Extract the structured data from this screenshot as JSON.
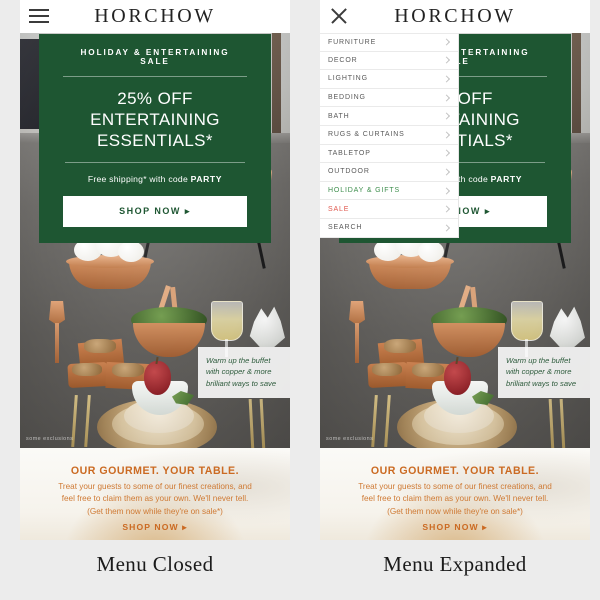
{
  "brand": "HORCHOW",
  "icons": {
    "hamburger": "hamburger-menu-icon",
    "close": "close-x-icon",
    "chevron": "chevron-right-icon",
    "arrow": "▸"
  },
  "promo": {
    "eyebrow": "HOLIDAY & ENTERTAINING SALE",
    "headline_line1": "25% OFF",
    "headline_line2": "ENTERTAINING ESSENTIALS*",
    "shipping_pre": "Free shipping* with code ",
    "shipping_code": "PARTY",
    "cta": "SHOP NOW ▸",
    "bg_color": "#1e5632",
    "text_color": "#ffffff"
  },
  "hero": {
    "callout": "Warm up the buffet with copper & more brilliant ways to save",
    "callout_color": "#2d5b3c",
    "exclusions": "some exclusions"
  },
  "gourmet": {
    "title": "OUR GOURMET. YOUR TABLE.",
    "body_line1": "Treat your guests to some of our finest creations, and",
    "body_line2": "feel free to claim them as your own. We'll never tell.",
    "body_line3": "(Get them now while they're on sale*)",
    "cta": "SHOP NOW ▸",
    "accent_color": "#cb6a22"
  },
  "nav": {
    "items": [
      {
        "label": "FURNITURE",
        "style": "default"
      },
      {
        "label": "DECOR",
        "style": "default"
      },
      {
        "label": "LIGHTING",
        "style": "default"
      },
      {
        "label": "BEDDING",
        "style": "default"
      },
      {
        "label": "BATH",
        "style": "default"
      },
      {
        "label": "RUGS & CURTAINS",
        "style": "default"
      },
      {
        "label": "TABLETOP",
        "style": "default"
      },
      {
        "label": "OUTDOOR",
        "style": "default"
      },
      {
        "label": "HOLIDAY & GIFTS",
        "style": "green"
      },
      {
        "label": "SALE",
        "style": "red"
      },
      {
        "label": "SEARCH",
        "style": "default"
      }
    ],
    "green_color": "#3f8f4e",
    "red_color": "#e0584e"
  },
  "captions": {
    "left": "Menu Closed",
    "right": "Menu Expanded"
  }
}
